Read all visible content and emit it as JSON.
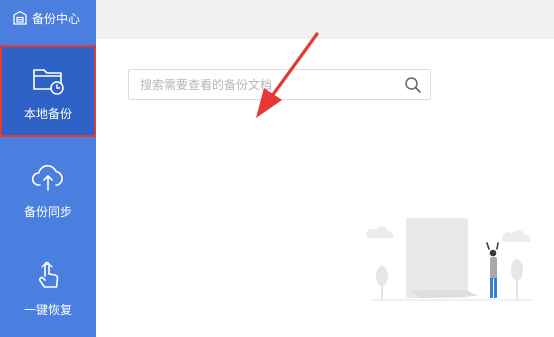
{
  "app": {
    "brand_label": "备份中心"
  },
  "sidebar": {
    "items": [
      {
        "label": "本地备份",
        "icon": "folder-clock-icon",
        "active": true
      },
      {
        "label": "备份同步",
        "icon": "cloud-upload-icon",
        "active": false
      },
      {
        "label": "一键恢复",
        "icon": "hand-pointer-icon",
        "active": false
      }
    ]
  },
  "search": {
    "placeholder": "搜索需要查看的备份文档",
    "value": ""
  },
  "colors": {
    "sidebar_bg": "#4a7fe0",
    "sidebar_active_bg": "#2f62c6",
    "highlight_border": "#e03a3a",
    "arrow": "#e53935"
  }
}
